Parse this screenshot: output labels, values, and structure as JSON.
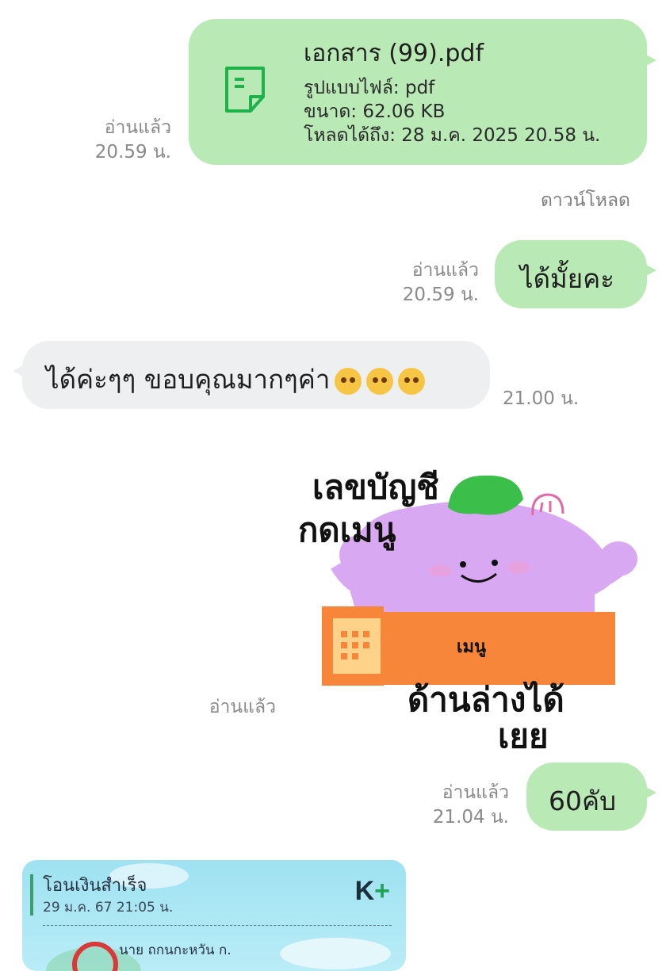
{
  "file_message": {
    "title": "เอกสาร (99).pdf",
    "type_line": "รูปแบบไฟล์: pdf",
    "size_line": "ขนาด: 62.06 KB",
    "expiry_line": "โหลดได้ถึง: 28 ม.ค. 2025 20.58 น.",
    "read": "อ่านแล้ว",
    "time": "20.59 น.",
    "download_label": "ดาวน์โหลด",
    "icon": "document-icon"
  },
  "message_2": {
    "text": "ได้มั้ยคะ",
    "read": "อ่านแล้ว",
    "time": "20.59 น."
  },
  "message_3": {
    "text": "ได้ค่ะๆๆ ขอบคุณมากๆค่า",
    "time": "21.00 น.",
    "emoji_icon": "pleading-face-icon"
  },
  "sticker": {
    "text_top_1": "เลขบัญชี",
    "text_top_2": "กดเมนู",
    "text_menu": "เมนู",
    "text_bottom_1": "ด้านล่างได้",
    "text_bottom_2": "เยย",
    "read": "อ่านแล้ว"
  },
  "message_5": {
    "text": "60คับ",
    "read": "อ่านแล้ว",
    "time": "21.04 น."
  },
  "transfer_slip": {
    "title": "โอนเงินสำเร็จ",
    "date": "29 ม.ค. 67  21:05 น.",
    "bank_logo": "K+",
    "name_partial": "นาย ถกนกะหวัน ก."
  },
  "colors": {
    "outgoing_bubble": "#b9e9b5",
    "incoming_bubble": "#eeeff1",
    "file_icon": "#1fb24a"
  }
}
